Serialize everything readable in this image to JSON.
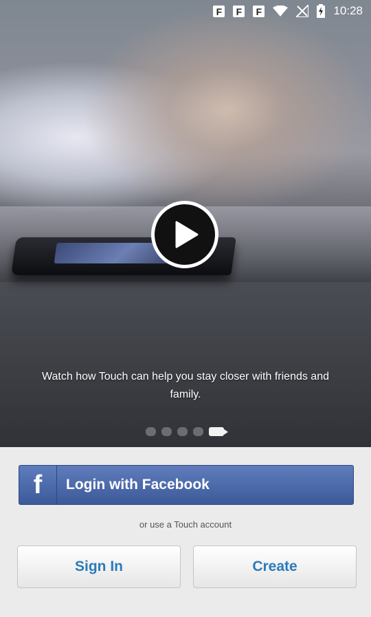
{
  "status_bar": {
    "notification_icons": [
      "F",
      "F",
      "F"
    ],
    "icons": [
      "facebook-notification-icon",
      "wifi-icon",
      "no-signal-icon",
      "battery-charging-icon"
    ],
    "time": "10:28"
  },
  "hero": {
    "play_icon": "play-icon"
  },
  "caption": {
    "text": "Watch how Touch can help you stay closer with friends and family."
  },
  "page_indicator": {
    "pages": 5,
    "current_icon": "camera-icon"
  },
  "facebook_login": {
    "logo": "f",
    "label": "Login with Facebook"
  },
  "touch_hint": "or use a Touch account",
  "buttons": {
    "sign_in": "Sign In",
    "create": "Create"
  },
  "colors": {
    "facebook_blue": "#3c5a99",
    "button_text_blue": "#2b7bb9",
    "panel_bg": "#ebebeb"
  }
}
